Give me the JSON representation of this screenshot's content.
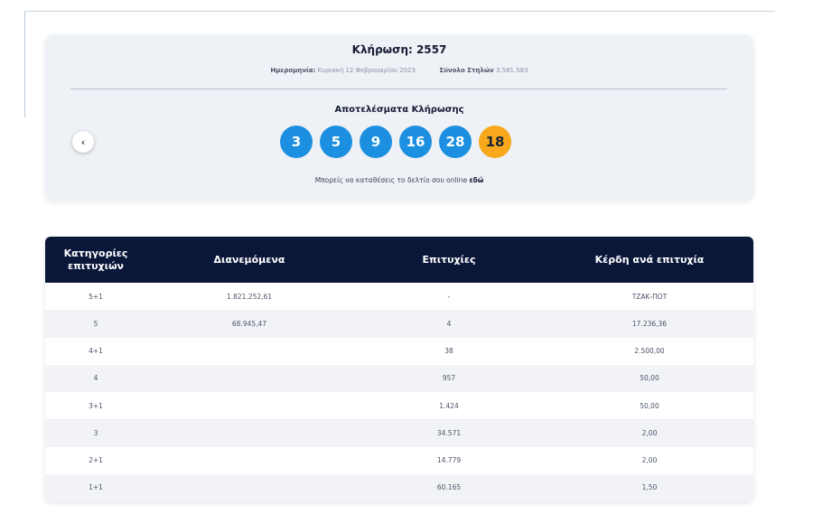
{
  "draw": {
    "title": "Κλήρωση: 2557",
    "date_label": "Ημερομηνία:",
    "date_value": "Κυριακή 12 Φεβρουαρίου 2023",
    "columns_label": "Σύνολο Στηλών",
    "columns_value": "3.581.583",
    "results_title": "Αποτελέσματα Κλήρωσης",
    "numbers": [
      "3",
      "5",
      "9",
      "16",
      "28"
    ],
    "bonus": "18",
    "ball_color": "#1c8fe0",
    "bonus_color": "#f7a81b",
    "prev_icon": "chevron-left-icon",
    "online_text": "Μπορείς να καταθέσεις το δελτίο σου online",
    "online_link": "εδώ"
  },
  "table": {
    "header_bg": "#0b1739",
    "headers": [
      "Κατηγορίες επιτυχιών",
      "Διανεμόμενα",
      "Επιτυχίες",
      "Κέρδη ανά επιτυχία"
    ],
    "rows": [
      [
        "5+1",
        "1.821.252,61",
        "-",
        "ΤΖΑΚ-ΠΟΤ"
      ],
      [
        "5",
        "68.945,47",
        "4",
        "17.236,36"
      ],
      [
        "4+1",
        "",
        "38",
        "2.500,00"
      ],
      [
        "4",
        "",
        "957",
        "50,00"
      ],
      [
        "3+1",
        "",
        "1.424",
        "50,00"
      ],
      [
        "3",
        "",
        "34.571",
        "2,00"
      ],
      [
        "2+1",
        "",
        "14.779",
        "2,00"
      ],
      [
        "1+1",
        "",
        "60.165",
        "1,50"
      ]
    ]
  }
}
